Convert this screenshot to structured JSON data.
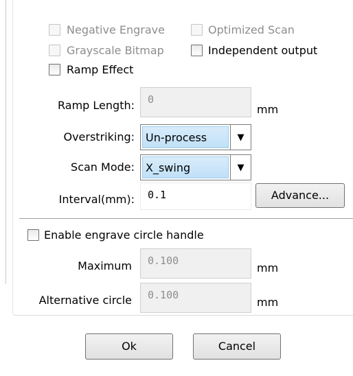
{
  "options": {
    "negative_engrave": "Negative Engrave",
    "optimized_scan": "Optimized Scan",
    "grayscale_bitmap": "Grayscale Bitmap",
    "independent_output": "Independent output",
    "ramp_effect": "Ramp Effect"
  },
  "ramp_length": {
    "label": "Ramp Length:",
    "value": "0",
    "unit": "mm"
  },
  "overstriking": {
    "label": "Overstriking:",
    "value": "Un-process"
  },
  "scan_mode": {
    "label": "Scan Mode:",
    "value": "X_swing"
  },
  "interval": {
    "label": "Interval(mm):",
    "value": "0.1",
    "advance_label": "Advance..."
  },
  "circle": {
    "enable_label": "Enable engrave circle handle",
    "maximum_label": "Maximum",
    "maximum_value": "0.100",
    "maximum_unit": "mm",
    "alternative_label": "Alternative circle",
    "alternative_value": "0.100",
    "alternative_unit": "mm"
  },
  "buttons": {
    "ok": "Ok",
    "cancel": "Cancel"
  }
}
